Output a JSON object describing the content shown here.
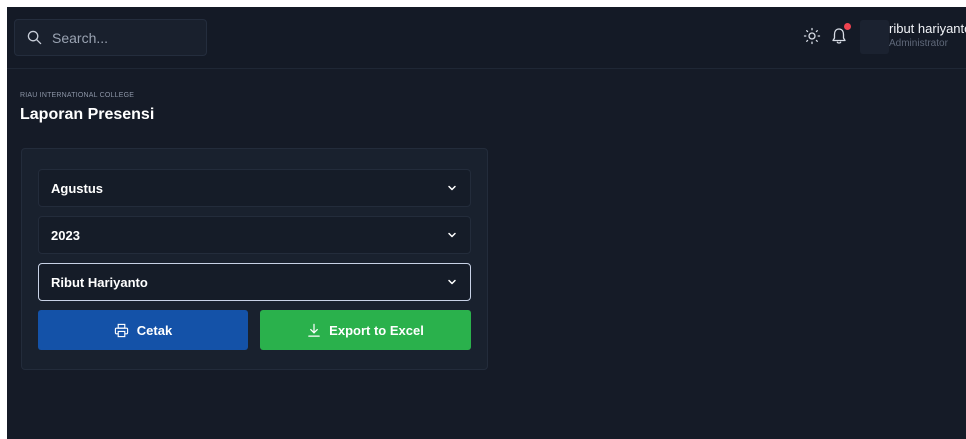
{
  "header": {
    "search_placeholder": "Search...",
    "user_name": "ribut hariyanto",
    "user_role": "Administrator"
  },
  "page": {
    "organization": "RIAU INTERNATIONAL COLLEGE",
    "title": "Laporan Presensi"
  },
  "form": {
    "month": "Agustus",
    "year": "2023",
    "employee": "Ribut Hariyanto",
    "print_label": "Cetak",
    "export_label": "Export to Excel"
  },
  "colors": {
    "primary_button": "#1452a8",
    "success_button": "#2ab14c",
    "notification_dot": "#ef4350"
  },
  "icons": [
    "search-icon",
    "sun-icon",
    "bell-icon",
    "chevron-down-icon",
    "printer-icon",
    "download-icon"
  ]
}
